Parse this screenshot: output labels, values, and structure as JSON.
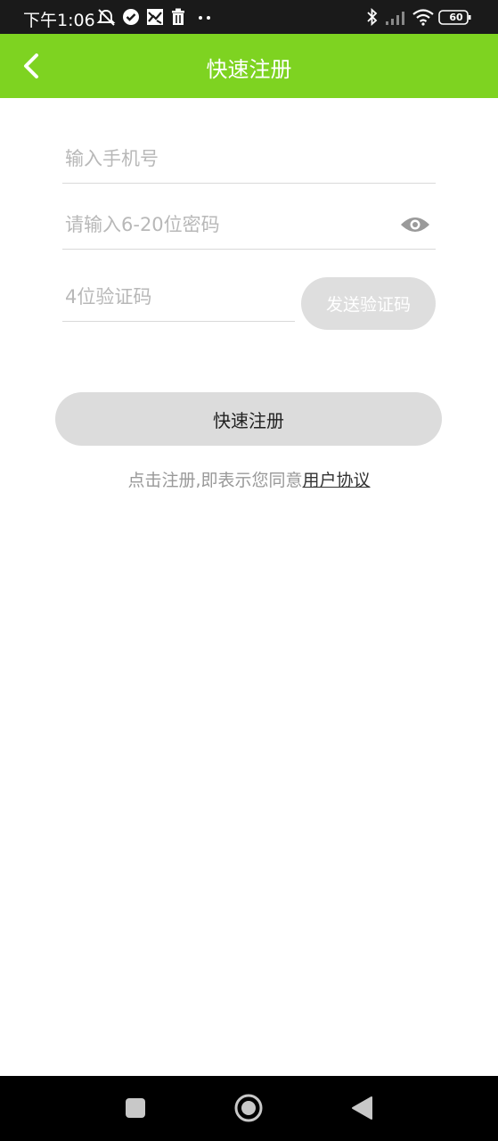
{
  "status_bar": {
    "time": "下午1:06",
    "battery": "60",
    "icons": [
      "muted-alarm-icon",
      "check-circle-icon",
      "photo-icon",
      "trash-icon",
      "more-dots-icon",
      "bluetooth-icon",
      "signal-icon",
      "wifi-icon",
      "battery-icon"
    ]
  },
  "header": {
    "title": "快速注册",
    "back_icon": "chevron-left-icon",
    "background": "#7ed321"
  },
  "form": {
    "phone_placeholder": "输入手机号",
    "password_placeholder": "请输入6-20位密码",
    "password_toggle_icon": "eye-icon",
    "code_placeholder": "4位验证码",
    "send_code_label": "发送验证码"
  },
  "register_button": {
    "label": "快速注册"
  },
  "agreement": {
    "prefix": "点击注册,即表示您同意",
    "link": "用户协议"
  },
  "nav_bar": {
    "icons": [
      "square-recent-icon",
      "circle-home-icon",
      "triangle-back-icon"
    ]
  }
}
